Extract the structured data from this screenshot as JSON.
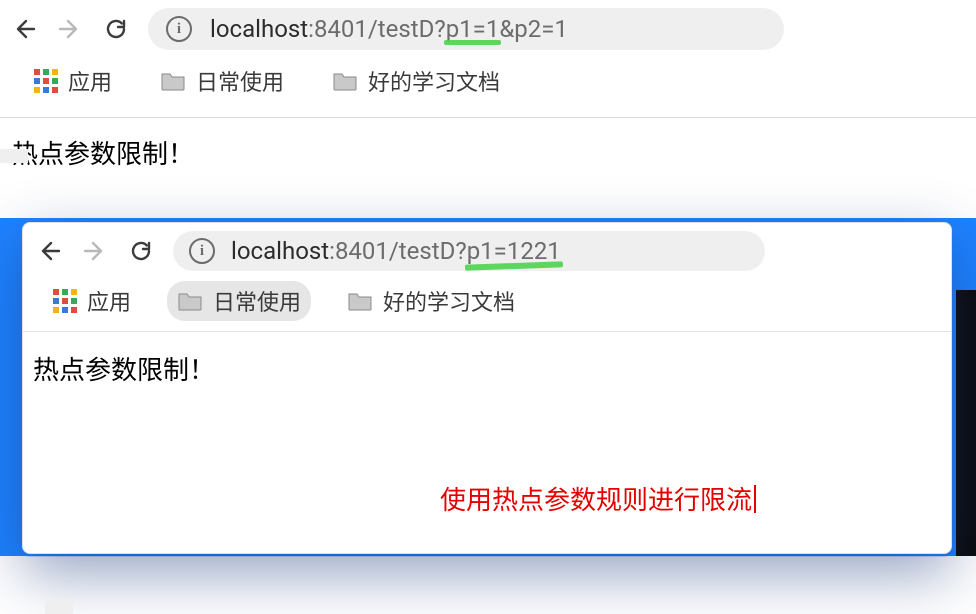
{
  "outer": {
    "url_host": "localhost",
    "url_path_a": ":8401/testD?",
    "url_hl": "p1=1",
    "url_path_b": "&p2=1",
    "bookmarks": {
      "apps": "应用",
      "daily": "日常使用",
      "docs": "好的学习文档"
    },
    "page_text": "热点参数限制！"
  },
  "inner": {
    "url_host": "localhost",
    "url_path_a": ":8401/testD?",
    "url_hl": "p1=1221",
    "bookmarks": {
      "apps": "应用",
      "daily": "日常使用",
      "docs": "好的学习文档"
    },
    "page_text": "热点参数限制！"
  },
  "annotation": "使用热点参数规则进行限流",
  "icons": {
    "info_glyph": "i"
  }
}
